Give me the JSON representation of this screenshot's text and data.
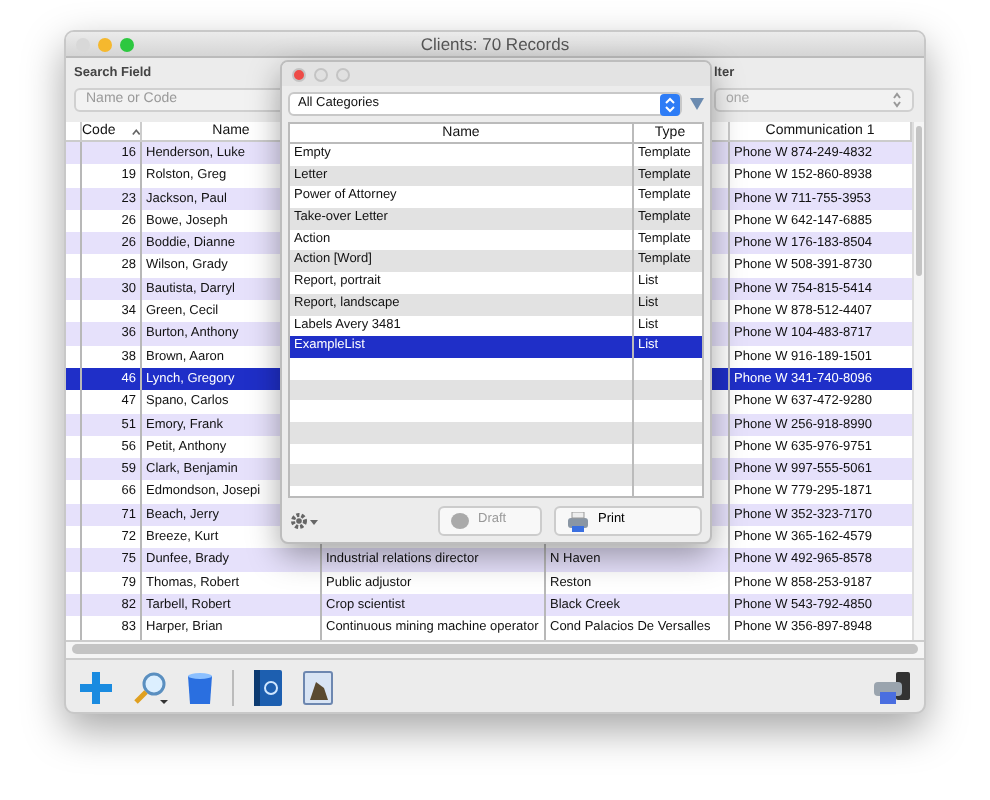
{
  "window": {
    "title": "Clients: 70 Records"
  },
  "search": {
    "label": "Search Field",
    "placeholder": "Name or Code"
  },
  "filter": {
    "label": "lter",
    "value": "one"
  },
  "table": {
    "columns": [
      "Code",
      "Name",
      "Communication 1"
    ],
    "rows": [
      {
        "code": "16",
        "name": "Henderson, Luke",
        "communication_1": "Phone W 874-249-4832",
        "selected": false
      },
      {
        "code": "19",
        "name": "Rolston, Greg",
        "communication_1": "Phone W 152-860-8938",
        "selected": false
      },
      {
        "code": "23",
        "name": "Jackson, Paul",
        "communication_1": "Phone W 711-755-3953",
        "selected": false
      },
      {
        "code": "26",
        "name": "Bowe, Joseph",
        "communication_1": "Phone W 642-147-6885",
        "selected": false
      },
      {
        "code": "26",
        "name": "Boddie, Dianne",
        "communication_1": "Phone W 176-183-8504",
        "selected": false
      },
      {
        "code": "28",
        "name": "Wilson, Grady",
        "communication_1": "Phone W 508-391-8730",
        "selected": false
      },
      {
        "code": "30",
        "name": "Bautista, Darryl",
        "communication_1": "Phone W 754-815-5414",
        "selected": false
      },
      {
        "code": "34",
        "name": "Green, Cecil",
        "communication_1": "Phone W 878-512-4407",
        "selected": false
      },
      {
        "code": "36",
        "name": "Burton, Anthony",
        "communication_1": "Phone W 104-483-8717",
        "selected": false
      },
      {
        "code": "38",
        "name": "Brown, Aaron",
        "communication_1": "Phone W 916-189-1501",
        "selected": false
      },
      {
        "code": "46",
        "name": "Lynch, Gregory",
        "communication_1": "Phone W 341-740-8096",
        "selected": true
      },
      {
        "code": "47",
        "name": "Spano, Carlos",
        "communication_1": "Phone W 637-472-9280",
        "selected": false
      },
      {
        "code": "51",
        "name": "Emory, Frank",
        "communication_1": "Phone W 256-918-8990",
        "selected": false
      },
      {
        "code": "56",
        "name": "Petit, Anthony",
        "communication_1": "Phone W 635-976-9751",
        "selected": false
      },
      {
        "code": "59",
        "name": "Clark, Benjamin",
        "communication_1": "Phone W 997-555-5061",
        "selected": false
      },
      {
        "code": "66",
        "name": "Edmondson, Josepi",
        "communication_1": "Phone W 779-295-1871",
        "selected": false
      },
      {
        "code": "71",
        "name": "Beach, Jerry",
        "communication_1": "Phone W 352-323-7170",
        "selected": false
      },
      {
        "code": "72",
        "name": "Breeze, Kurt",
        "communication_1": "Phone W 365-162-4579",
        "selected": false
      },
      {
        "code": "75",
        "name": "Dunfee, Brady",
        "column_3": "Industrial relations director",
        "column_4": "N Haven",
        "communication_1": "Phone W 492-965-8578",
        "selected": false
      },
      {
        "code": "79",
        "name": "Thomas, Robert",
        "column_3": "Public adjustor",
        "column_4": "Reston",
        "communication_1": "Phone W 858-253-9187",
        "selected": false
      },
      {
        "code": "82",
        "name": "Tarbell, Robert",
        "column_3": "Crop scientist",
        "column_4": "Black Creek",
        "communication_1": "Phone W 543-792-4850",
        "selected": false
      },
      {
        "code": "83",
        "name": "Harper, Brian",
        "column_3": "Continuous mining machine operator",
        "column_4": "Cond Palacios De Versalles",
        "communication_1": "Phone W 356-897-8948",
        "selected": false
      }
    ]
  },
  "dialog": {
    "category": "All Categories",
    "columns": [
      "Name",
      "Type"
    ],
    "items": [
      {
        "name": "Empty",
        "type": "Template",
        "selected": false
      },
      {
        "name": "Letter",
        "type": "Template",
        "selected": false
      },
      {
        "name": "Power of Attorney",
        "type": "Template",
        "selected": false
      },
      {
        "name": "Take-over Letter",
        "type": "Template",
        "selected": false
      },
      {
        "name": "Action",
        "type": "Template",
        "selected": false
      },
      {
        "name": "Action [Word]",
        "type": "Template",
        "selected": false
      },
      {
        "name": "Report, portrait",
        "type": "List",
        "selected": false
      },
      {
        "name": "Report, landscape",
        "type": "List",
        "selected": false
      },
      {
        "name": "Labels Avery 3481",
        "type": "List",
        "selected": false
      },
      {
        "name": "ExampleList",
        "type": "List",
        "selected": true
      }
    ],
    "buttons": [
      {
        "label": "Draft",
        "disabled": true
      },
      {
        "label": "Print",
        "disabled": false
      }
    ]
  }
}
